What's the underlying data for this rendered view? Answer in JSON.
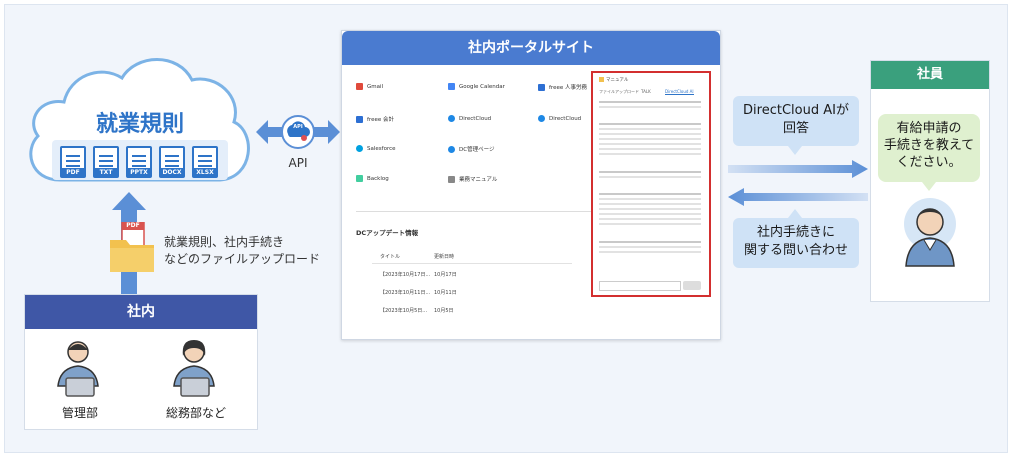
{
  "cloud": {
    "title": "就業規則",
    "files": [
      "PDF",
      "TXT",
      "PPTX",
      "DOCX",
      "XLSX"
    ]
  },
  "api": {
    "label": "API",
    "badge": "API"
  },
  "upload": {
    "line1": "就業規則、社内手続き",
    "line2": "などのファイルアップロード",
    "pdf_tag": "PDF"
  },
  "internal": {
    "title": "社内",
    "people": [
      "管理部",
      "総務部など"
    ]
  },
  "portal": {
    "title": "社内ポータルサイト",
    "links": [
      "Gmail",
      "Google Calendar",
      "freee 人事労務",
      "freee 会計",
      "DirectCloud",
      "DirectCloud",
      "Salesforce",
      "DC管理ページ",
      "Backlog",
      "業務マニュアル"
    ],
    "update": {
      "title": "DCアップデート情報",
      "columns": [
        "タイトル",
        "更新日時"
      ],
      "rows": [
        [
          "【2023年10月17日...",
          "10月17日"
        ],
        [
          "【2023年10月11日...",
          "10月11日"
        ],
        [
          "【2023年10月5日...",
          "10月5日"
        ]
      ]
    },
    "chat": {
      "header": "マニュアル",
      "tabs": [
        "ファイルアップロード",
        "TALK",
        "DirectCloud AI"
      ]
    }
  },
  "bubbles": {
    "reply_line1": "DirectCloud AIが",
    "reply_line2": "回答",
    "inquiry_line1": "社内手続きに",
    "inquiry_line2": "関する問い合わせ"
  },
  "employee": {
    "title": "社員",
    "question_line1": "有給申請の",
    "question_line2": "手続きを教えて",
    "question_line3": "ください。"
  },
  "colors": {
    "blue": "#2e74c8",
    "navy": "#3f57a6",
    "green": "#3aa07d",
    "portal": "#4a7bd0",
    "highlight": "#d32f2f"
  }
}
